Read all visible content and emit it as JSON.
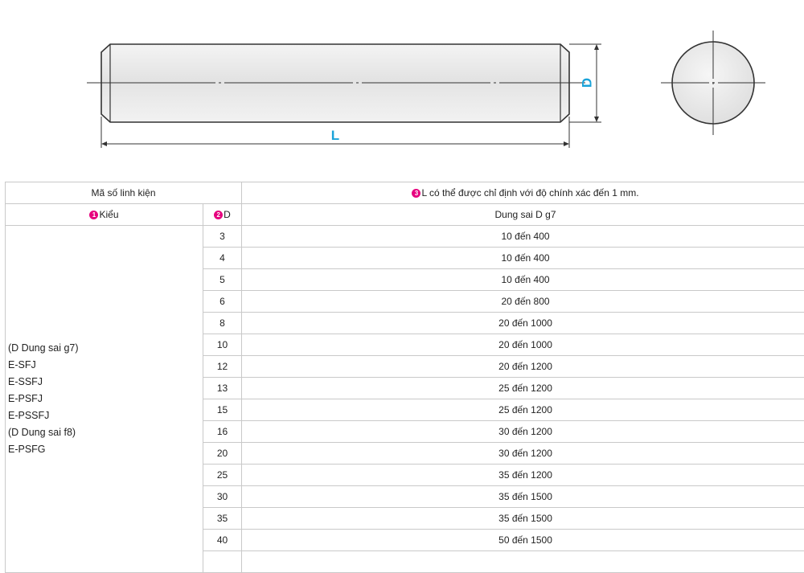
{
  "drawing": {
    "length_label": "L",
    "diameter_label": "D"
  },
  "table": {
    "header1": {
      "part_number": "Mã số linh kiện",
      "badge3": "3",
      "length_note": "L có thể được chỉ định với độ chính xác đến 1 mm."
    },
    "header2": {
      "badge1": "1",
      "type": "Kiểu",
      "badge2": "2",
      "d": "D",
      "tolerance": "Dung sai D g7"
    },
    "types": [
      "(D Dung sai g7)",
      "E-SFJ",
      "E-SSFJ",
      "E-PSFJ",
      "E-PSSFJ",
      "(D Dung sai f8)",
      "E-PSFG"
    ],
    "rows": [
      {
        "d": "3",
        "l": "10 đến 400"
      },
      {
        "d": "4",
        "l": "10 đến 400"
      },
      {
        "d": "5",
        "l": "10 đến 400"
      },
      {
        "d": "6",
        "l": "20 đến 800"
      },
      {
        "d": "8",
        "l": "20 đến 1000"
      },
      {
        "d": "10",
        "l": "20 đến 1000"
      },
      {
        "d": "12",
        "l": "20 đến 1200"
      },
      {
        "d": "13",
        "l": "25 đến 1200"
      },
      {
        "d": "15",
        "l": "25 đến 1200"
      },
      {
        "d": "16",
        "l": "30 đến 1200"
      },
      {
        "d": "20",
        "l": "30 đến 1200"
      },
      {
        "d": "25",
        "l": "35 đến 1200"
      },
      {
        "d": "30",
        "l": "35 đến 1500"
      },
      {
        "d": "35",
        "l": "35 đến 1500"
      },
      {
        "d": "40",
        "l": "50 đến 1500"
      }
    ],
    "colors": {
      "badge": "#e6007e",
      "dimension_label": "#1aa3d9",
      "border": "#c9c9c9"
    }
  }
}
